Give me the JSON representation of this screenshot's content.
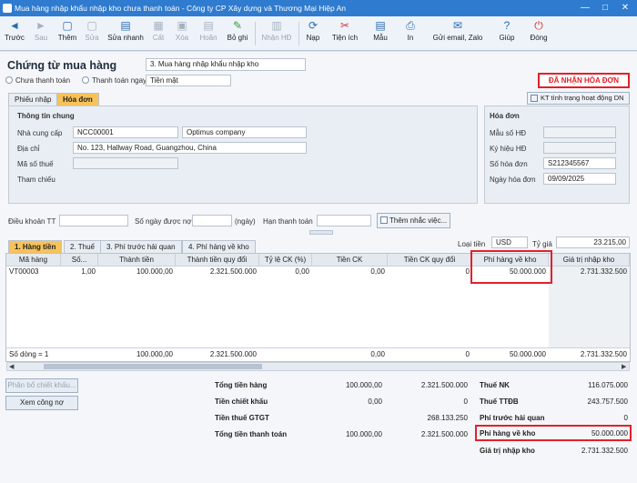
{
  "window": {
    "title": "Mua hàng nhập khẩu nhập kho chưa thanh toán - Công ty CP Xây dựng và Thương Mại Hiệp An",
    "min": "—",
    "max": "□",
    "close": "✕"
  },
  "toolbar": {
    "items": [
      {
        "label": "Trước",
        "icon": "◄"
      },
      {
        "label": "Sau",
        "icon": "►"
      },
      {
        "label": "Thêm",
        "icon": "▢"
      },
      {
        "label": "Sửa",
        "icon": "▢"
      },
      {
        "label": "Sửa nhanh",
        "icon": "▤"
      },
      {
        "label": "Cất",
        "icon": "▦"
      },
      {
        "label": "Xóa",
        "icon": "▣"
      },
      {
        "label": "Hoãn",
        "icon": "▤"
      },
      {
        "label": "Bỏ ghi",
        "icon": "✎"
      },
      {
        "label": "Nhận HĐ",
        "icon": "▥"
      },
      {
        "label": "Nạp",
        "icon": "⟳"
      },
      {
        "label": "Tiện ích",
        "icon": "✂"
      },
      {
        "label": "Mẫu",
        "icon": "▤"
      },
      {
        "label": "In",
        "icon": "⎙"
      },
      {
        "label": "Gửi email, Zalo",
        "icon": "✉"
      },
      {
        "label": "Giúp",
        "icon": "?"
      },
      {
        "label": "Đóng",
        "icon": "⏻"
      }
    ]
  },
  "header": {
    "title": "Chứng từ mua hàng",
    "type_value": "3. Mua hàng nhập khẩu nhập kho",
    "radio1": "Chưa thanh toán",
    "radio2": "Thanh toán ngay",
    "pay_method": "Tiền mặt",
    "status_badge": "ĐÃ NHẬN HÓA ĐƠN",
    "kt_button": "KT tình trạng hoạt động DN"
  },
  "tabs_top": [
    "Phiếu nhập",
    "Hóa đơn"
  ],
  "general": {
    "title": "Thông tin chung",
    "supplier_label": "Nhà cung cấp",
    "supplier_code": "NCC00001",
    "supplier_name": "Optimus company",
    "address_label": "Địa chỉ",
    "address": "No. 123, Hallway Road, Guangzhou, China",
    "tax_label": "Mã số thuế",
    "ref_label": "Tham chiếu"
  },
  "invoice": {
    "title": "Hóa đơn",
    "form_label": "Mẫu số HĐ",
    "symbol_label": "Ký hiệu HĐ",
    "number_label": "Số hóa đơn",
    "number": "S212345567",
    "date_label": "Ngày hóa đơn",
    "date": "09/09/2025"
  },
  "terms": {
    "dk_label": "Điều khoản TT",
    "days_label": "Số ngày được nợ",
    "days_unit": "(ngày)",
    "due_label": "Hạn thanh toán",
    "reminder_button": "Thêm nhắc việc..."
  },
  "tabs_bottom": [
    "1. Hàng tiền",
    "2. Thuế",
    "3. Phí trước hải quan",
    "4. Phí hàng về kho"
  ],
  "currency": {
    "label": "Loại tiền",
    "value": "USD",
    "rate_label": "Tỷ giá",
    "rate": "23.215,00"
  },
  "grid": {
    "headers": [
      "Mã hàng",
      "Số...",
      "Thành tiền",
      "Thành tiền quy đổi",
      "Tỷ lệ CK (%)",
      "Tiền CK",
      "Tiền CK quy đổi",
      "Phí hàng về kho",
      "Giá trị nhập kho"
    ],
    "row": [
      "VT00003",
      "1,00",
      "100.000,00",
      "2.321.500.000",
      "0,00",
      "0,00",
      "0",
      "50.000.000",
      "2.731.332.500"
    ],
    "footer": [
      "Số dòng = 1",
      "",
      "100.000,00",
      "2.321.500.000",
      "",
      "0,00",
      "0",
      "50.000.000",
      "2.731.332.500"
    ]
  },
  "buttons": {
    "allocate": "Phân bổ chiết khấu...",
    "debt": "Xem công nợ"
  },
  "totals": {
    "left": [
      {
        "label": "Tổng tiền hàng",
        "v1": "100.000,00",
        "v2": "2.321.500.000"
      },
      {
        "label": "Tiền chiết khấu",
        "v1": "0,00",
        "v2": "0"
      },
      {
        "label": "Tiền thuế GTGT",
        "v1": "",
        "v2": "268.133.250"
      },
      {
        "label": "Tổng tiền thanh toán",
        "v1": "100.000,00",
        "v2": "2.321.500.000"
      }
    ],
    "right": [
      {
        "label": "Thuế NK",
        "value": "116.075.000"
      },
      {
        "label": "Thuế TTĐB",
        "value": "243.757.500"
      },
      {
        "label": "Phí trước hải quan",
        "value": "0"
      },
      {
        "label": "Phí hàng về kho",
        "value": "50.000.000"
      },
      {
        "label": "Giá trị nhập kho",
        "value": "2.731.332.500"
      }
    ]
  },
  "colors": {
    "accent": "#2e7bcf",
    "tab_active": "#f7c25a",
    "highlight": "#e3202a"
  }
}
